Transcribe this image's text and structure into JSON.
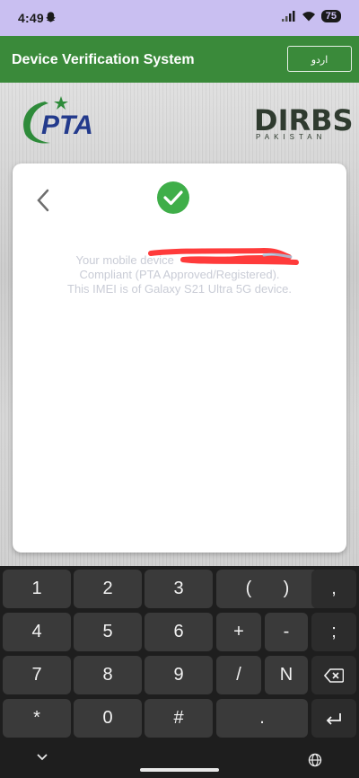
{
  "status_bar": {
    "time": "4:49",
    "battery": "75"
  },
  "app_header": {
    "title": "Device Verification System",
    "language_button": "اردو"
  },
  "logos": {
    "pta": "PTA",
    "dirbs_word": "DIRBS",
    "dirbs_sub": "PAKISTAN"
  },
  "result_card": {
    "message_line1": "Your mobile device",
    "message_line1_end": "is",
    "message_line2": "Compliant (PTA Approved/Registered).",
    "message_line3": "This IMEI is of Galaxy S21 Ultra 5G device."
  },
  "keyboard": {
    "row1": [
      "1",
      "2",
      "3",
      "(",
      ")",
      ","
    ],
    "row2": [
      "4",
      "5",
      "6",
      "+",
      "-",
      ";"
    ],
    "row3": [
      "7",
      "8",
      "9",
      "/",
      "N"
    ],
    "row4": [
      "*",
      "0",
      "#",
      "."
    ]
  },
  "colors": {
    "header_green": "#3a8a3a",
    "check_green": "#3fae49",
    "status_bg": "#c9bff1"
  }
}
